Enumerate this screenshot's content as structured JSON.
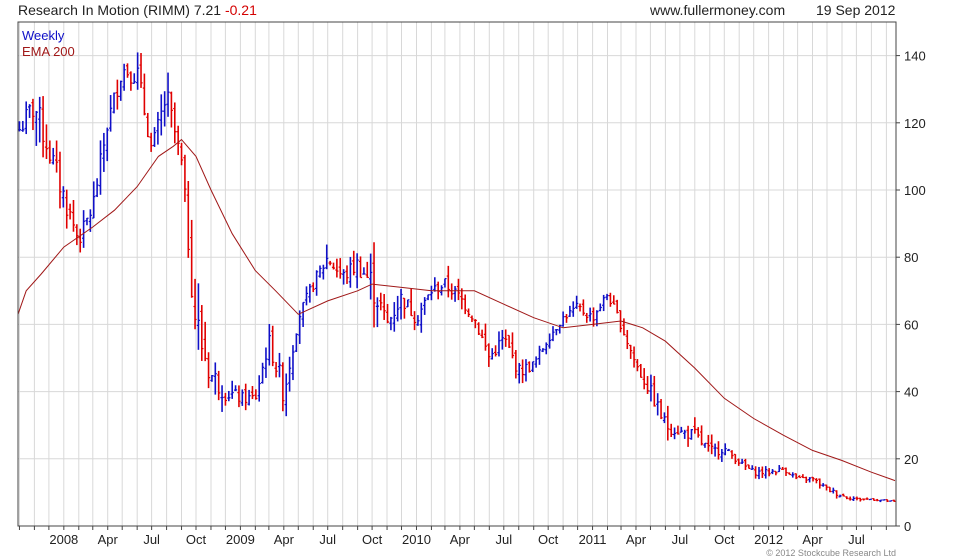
{
  "header": {
    "title": "Research In Motion (RIMM) 7.21",
    "change": "-0.21",
    "source": "www.fullermoney.com",
    "date": "19 Sep 2012"
  },
  "footer": {
    "copyright": "© 2012 Stockcube Research Ltd"
  },
  "colors": {
    "up": "#1010c8",
    "down": "#e00000",
    "ema": "#a01818",
    "grid": "#d8d8d8",
    "frame": "#444444"
  },
  "chart_data": {
    "type": "line",
    "title": "Research In Motion (RIMM) 7.21 -0.21",
    "ylim": [
      0,
      150
    ],
    "yticks": [
      0,
      20,
      40,
      60,
      80,
      100,
      120,
      140
    ],
    "x_tick_labels": [
      "2008",
      "Apr",
      "Jul",
      "Oct",
      "2009",
      "Apr",
      "Jul",
      "Oct",
      "2010",
      "Apr",
      "Jul",
      "Oct",
      "2011",
      "Apr",
      "Jul",
      "Oct",
      "2012",
      "Apr",
      "Jul"
    ],
    "grid": true,
    "legend_position": "top-left",
    "x_range": [
      "2007-09-28",
      "2012-09-21"
    ],
    "series": [
      {
        "name": "Weekly",
        "kind": "bars",
        "x": [
          "2007-10-01",
          "2007-11-01",
          "2007-12-01",
          "2008-01-01",
          "2008-02-01",
          "2008-03-01",
          "2008-04-01",
          "2008-05-01",
          "2008-06-01",
          "2008-07-01",
          "2008-08-01",
          "2008-09-01",
          "2008-10-01",
          "2008-11-01",
          "2008-12-01",
          "2009-01-01",
          "2009-02-01",
          "2009-03-01",
          "2009-04-01",
          "2009-05-01",
          "2009-06-01",
          "2009-07-01",
          "2009-08-01",
          "2009-09-01",
          "2009-10-01",
          "2009-11-01",
          "2009-12-01",
          "2010-01-01",
          "2010-02-01",
          "2010-03-01",
          "2010-04-01",
          "2010-05-01",
          "2010-06-01",
          "2010-07-01",
          "2010-08-01",
          "2010-09-01",
          "2010-10-01",
          "2010-11-01",
          "2010-12-01",
          "2011-01-01",
          "2011-02-01",
          "2011-03-01",
          "2011-04-01",
          "2011-05-01",
          "2011-06-01",
          "2011-07-01",
          "2011-08-01",
          "2011-09-01",
          "2011-10-01",
          "2011-11-01",
          "2011-12-01",
          "2012-01-01",
          "2012-02-01",
          "2012-03-01",
          "2012-04-01",
          "2012-05-01",
          "2012-06-01",
          "2012-07-01",
          "2012-08-01",
          "2012-09-01",
          "2012-09-19"
        ],
        "values": [
          118,
          125,
          112,
          98,
          85,
          95,
          120,
          136,
          135,
          112,
          128,
          108,
          60,
          45,
          40,
          38,
          38,
          55,
          40,
          62,
          72,
          80,
          74,
          78,
          72,
          60,
          68,
          62,
          70,
          72,
          68,
          62,
          50,
          56,
          46,
          48,
          56,
          62,
          65,
          62,
          69,
          60,
          48,
          40,
          30,
          28,
          27,
          22,
          23,
          19,
          16,
          16,
          17,
          14,
          14,
          11,
          9,
          8,
          8,
          7.5,
          7.21
        ],
        "highs": [
          121,
          137,
          122,
          105,
          92,
          105,
          128,
          145,
          148,
          120,
          134,
          112,
          95,
          62,
          52,
          45,
          46,
          62,
          60,
          68,
          76,
          86,
          80,
          84,
          88,
          69,
          73,
          71,
          74,
          77,
          73,
          68,
          58,
          59,
          54,
          53,
          58,
          64,
          69,
          67,
          71,
          63,
          57,
          46,
          38,
          30,
          34,
          29,
          25,
          21,
          18,
          18,
          18,
          15,
          15,
          13,
          11,
          9,
          9,
          8.5,
          7.4
        ],
        "lows": [
          105,
          110,
          98,
          82,
          80,
          88,
          112,
          128,
          125,
          108,
          112,
          100,
          48,
          38,
          36,
          35,
          35,
          48,
          36,
          58,
          66,
          70,
          66,
          68,
          58,
          55,
          58,
          58,
          64,
          66,
          62,
          56,
          46,
          48,
          42,
          44,
          50,
          58,
          60,
          58,
          64,
          54,
          44,
          34,
          24,
          23,
          22,
          18,
          19,
          17,
          13,
          13,
          14,
          12,
          11,
          9,
          7,
          7,
          7,
          7,
          7
        ]
      },
      {
        "name": "EMA 200",
        "kind": "line",
        "x": [
          "2007-09-28",
          "2007-10-15",
          "2007-11-15",
          "2008-01-01",
          "2008-03-01",
          "2008-04-15",
          "2008-06-01",
          "2008-07-15",
          "2008-08-15",
          "2008-09-01",
          "2008-10-01",
          "2008-11-01",
          "2008-12-15",
          "2009-02-01",
          "2009-03-15",
          "2009-05-01",
          "2009-07-01",
          "2009-09-01",
          "2009-10-01",
          "2009-12-01",
          "2010-02-01",
          "2010-03-15",
          "2010-05-01",
          "2010-07-01",
          "2010-09-01",
          "2010-11-01",
          "2011-01-01",
          "2011-03-01",
          "2011-04-15",
          "2011-06-01",
          "2011-08-01",
          "2011-10-01",
          "2011-12-01",
          "2012-02-01",
          "2012-04-01",
          "2012-06-01",
          "2012-08-01",
          "2012-09-19"
        ],
        "values": [
          63,
          70,
          75,
          83,
          89,
          94,
          101,
          110,
          113,
          115,
          110,
          100,
          87,
          76,
          70,
          63,
          67,
          70,
          72,
          71,
          70,
          70,
          70,
          66,
          62,
          59,
          60,
          61,
          59,
          55,
          47,
          38,
          32,
          27,
          22.5,
          19.5,
          16,
          13.5
        ]
      }
    ]
  }
}
